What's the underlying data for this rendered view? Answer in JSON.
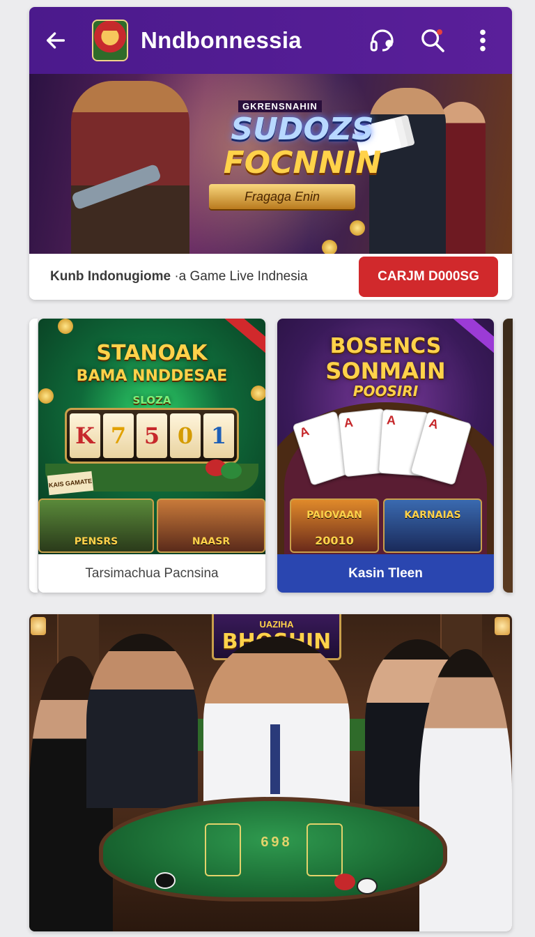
{
  "header": {
    "title": "Nndbonnessia",
    "back_icon": "arrow-left-icon",
    "support_icon": "headset-icon",
    "search_icon": "search-icon",
    "menu_icon": "more-vertical-icon",
    "notification_dot_color": "#e6413d",
    "bar_color": "#4b1a8c"
  },
  "hero": {
    "kicker": "GKRENSNAHIN",
    "title_line1": "SUDOZS",
    "title_line2": "FOCNNIN",
    "ribbon": "Fragaga Enin",
    "caption_bold": "Kunb Indonugiome",
    "caption_rest": " ·a Game Live Indnesia",
    "cta_label": "CARJM D000SG",
    "cta_color": "#d1292c"
  },
  "games": [
    {
      "art_title_1": "STANOAK",
      "art_title_2": "BAMA NNDDESAE",
      "reel_badge": "SLOZA",
      "reels": [
        "K",
        "7",
        "5",
        "0",
        "1"
      ],
      "sign": "KAIS GAMATE",
      "thumb_labels": [
        "PENSRS",
        "NAASR"
      ],
      "label": "Tarsimachua Pacnsina"
    },
    {
      "art_title_1": "BOSENCS",
      "art_title_2": "SONMAIN",
      "art_title_3": "POOSIRI",
      "thumb_labels": [
        "PAIOVAAN",
        "KARNAIAS"
      ],
      "thumb_number": "20010",
      "label": "Kasin Tleen",
      "footer_color": "#2a46b0"
    }
  ],
  "live": {
    "sign": "BHOSHIN",
    "sign_top": "UAZIHA",
    "table_text": "698"
  }
}
